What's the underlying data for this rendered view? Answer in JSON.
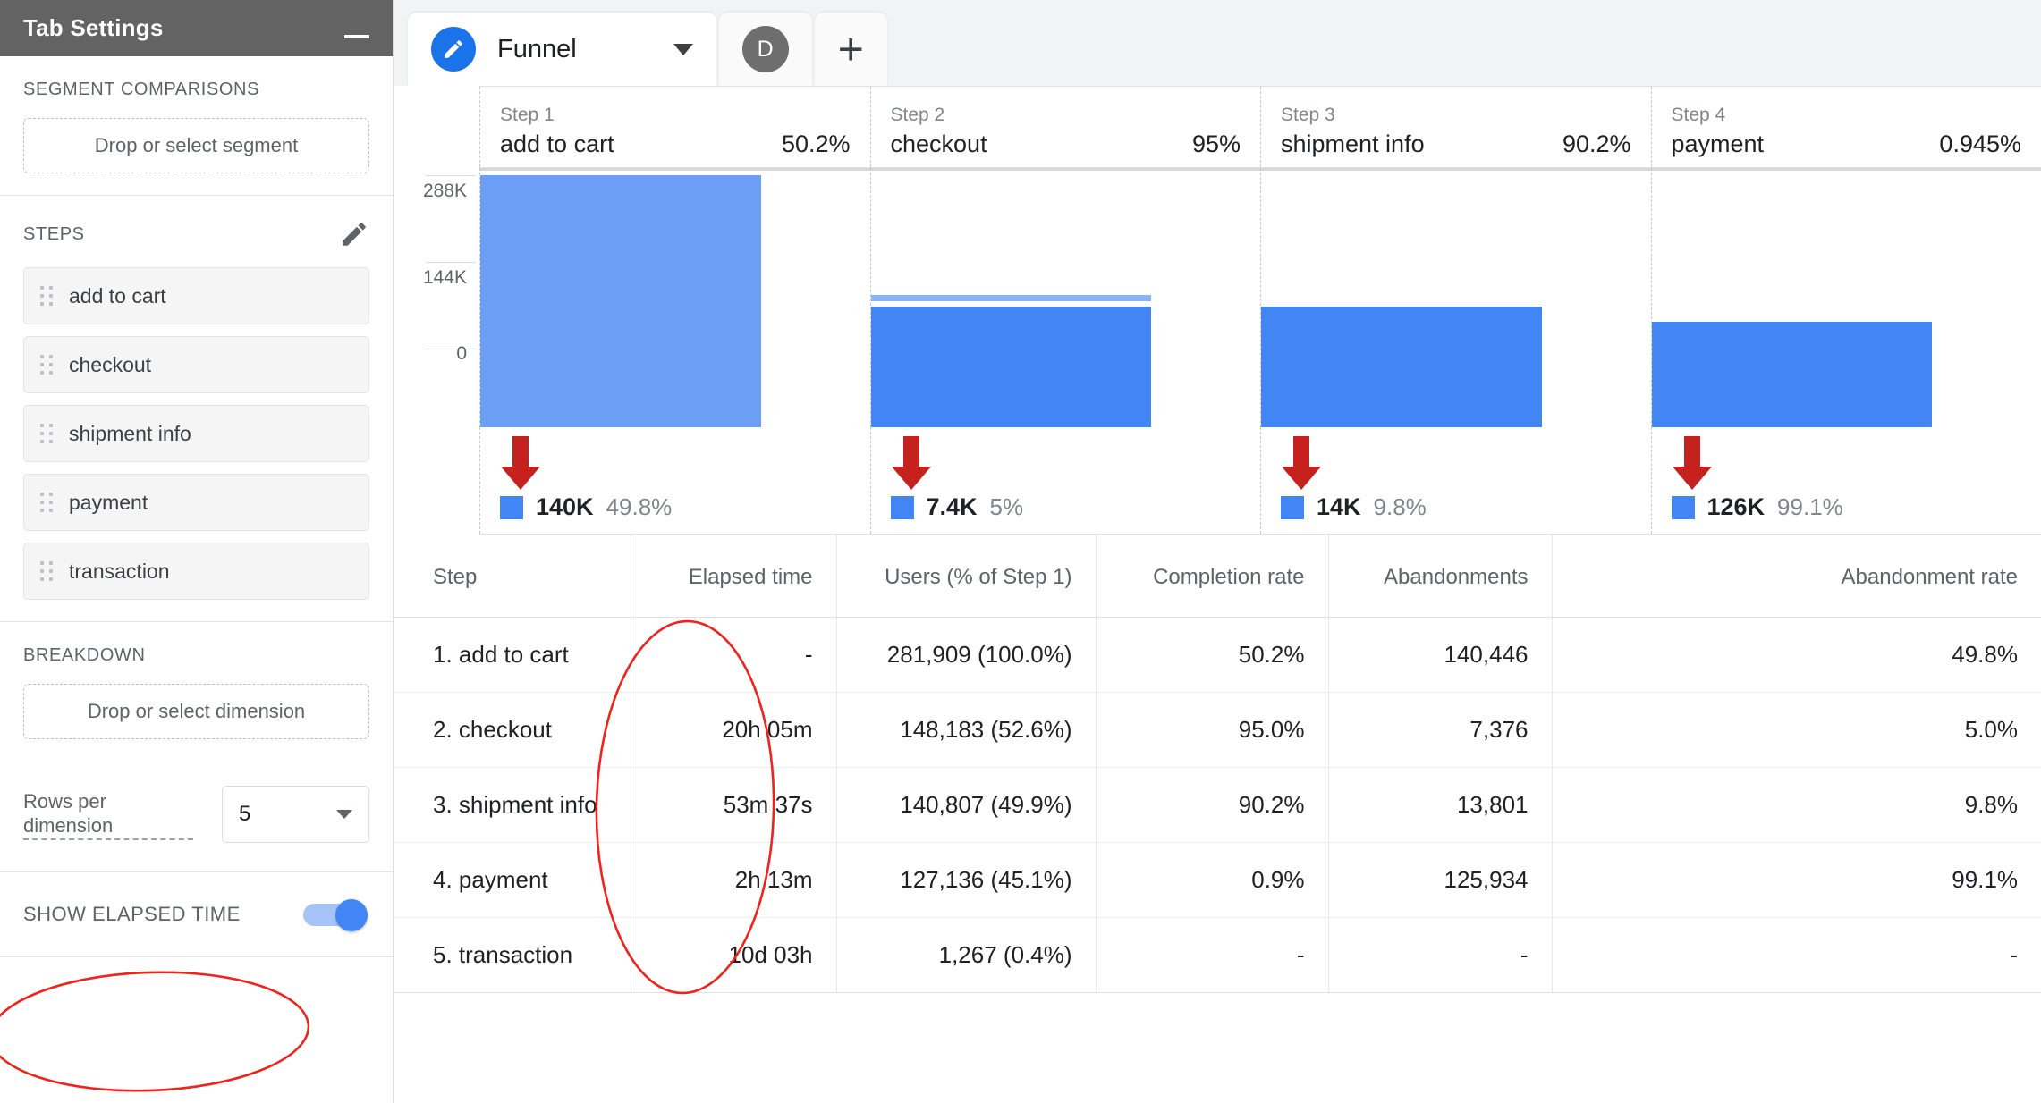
{
  "sidebar": {
    "title": "Tab Settings",
    "minimize_icon": "minimize-icon",
    "segment_section": {
      "label": "SEGMENT COMPARISONS",
      "dropzone_text": "Drop or select segment"
    },
    "steps_section": {
      "label": "STEPS",
      "edit_icon": "pencil-icon",
      "items": [
        {
          "label": "add to cart"
        },
        {
          "label": "checkout"
        },
        {
          "label": "shipment info"
        },
        {
          "label": "payment"
        },
        {
          "label": "transaction"
        }
      ]
    },
    "breakdown_section": {
      "label": "BREAKDOWN",
      "dropzone_text": "Drop or select dimension"
    },
    "rows_per_dimension": {
      "label": "Rows per dimension",
      "value": "5"
    },
    "show_elapsed_time": {
      "label": "SHOW ELAPSED TIME",
      "state": "on"
    }
  },
  "tabbar": {
    "active_tab": {
      "icon": "pencil-icon",
      "title": "Funnel",
      "caret": "chevron-down-icon"
    },
    "avatar_tab": {
      "initial": "D"
    },
    "add_tab": {
      "glyph": "+"
    }
  },
  "chart_data": {
    "type": "bar",
    "title": "Funnel",
    "categories": [
      "add to cart",
      "checkout",
      "shipment info",
      "payment"
    ],
    "step_numbers": [
      "Step 1",
      "Step 2",
      "Step 3",
      "Step 4"
    ],
    "completion_labels": [
      "50.2%",
      "95%",
      "90.2%",
      "0.945%"
    ],
    "values": [
      281909,
      148183,
      140807,
      127136
    ],
    "values_display": [
      "281,909",
      "148,183",
      "140,807",
      "127,136"
    ],
    "abandonment_values": [
      140446,
      7376,
      13801,
      125934
    ],
    "abandonment_display": [
      "140K",
      "7.4K",
      "14K",
      "126K"
    ],
    "abandonment_pct": [
      "49.8%",
      "5%",
      "9.8%",
      "99.1%"
    ],
    "ylim": [
      0,
      288000
    ],
    "ytick_labels": [
      "288K",
      "144K",
      "0"
    ],
    "ytick_values": [
      288000,
      144000,
      0
    ],
    "ylabel": "",
    "xlabel": "",
    "grid": true,
    "legend": "per-column",
    "bar_color": "#4285f4",
    "first_bar_color": "#6b9ff5",
    "dropoff_color": "#8ab4f8",
    "arrow_color": "#c5221f"
  },
  "table": {
    "columns": [
      "Step",
      "Elapsed time",
      "Users (% of Step 1)",
      "Completion rate",
      "Abandonments",
      "Abandonment rate"
    ],
    "rows": [
      [
        "1. add to cart",
        "-",
        "281,909 (100.0%)",
        "50.2%",
        "140,446",
        "49.8%"
      ],
      [
        "2. checkout",
        "20h 05m",
        "148,183 (52.6%)",
        "95.0%",
        "7,376",
        "5.0%"
      ],
      [
        "3. shipment info",
        "53m 37s",
        "140,807 (49.9%)",
        "90.2%",
        "13,801",
        "9.8%"
      ],
      [
        "4. payment",
        "2h 13m",
        "127,136 (45.1%)",
        "0.9%",
        "125,934",
        "99.1%"
      ],
      [
        "5. transaction",
        "10d 03h",
        "1,267 (0.4%)",
        "-",
        "-",
        "-"
      ]
    ]
  },
  "annotations": {
    "accent_color": "#f0231c",
    "ellipses": [
      "elapsed-time-column",
      "show-elapsed-time-toggle"
    ]
  }
}
